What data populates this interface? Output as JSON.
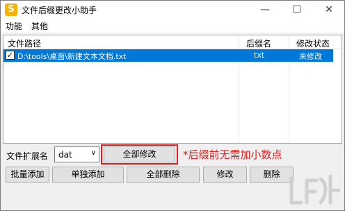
{
  "window": {
    "title": "文件后缀更改小助手",
    "icon_letter": "S",
    "icon_color": "#f5b400",
    "minimize_glyph": "—",
    "maximize_glyph": "☐",
    "close_glyph": "✕"
  },
  "menu": {
    "items": [
      "功能",
      "其他"
    ]
  },
  "list": {
    "columns": [
      "文件路径",
      "后缀名",
      "修改状态"
    ],
    "rows": [
      {
        "checked": true,
        "path": "D:\\tools\\桌面\\新建文本文档.txt",
        "suffix": "txt",
        "status": "未修改"
      }
    ],
    "selection_color": "#0078d7"
  },
  "controls": {
    "ext_label": "文件扩展名",
    "ext_value": "dat",
    "apply_all_label": "全部修改",
    "note": "*后缀前无需加小数点",
    "note_color": "#e02020"
  },
  "buttons": {
    "batch_add": "批量添加",
    "single_add": "单独添加",
    "delete_all": "全部删除",
    "modify": "修改",
    "delete": "删除"
  }
}
